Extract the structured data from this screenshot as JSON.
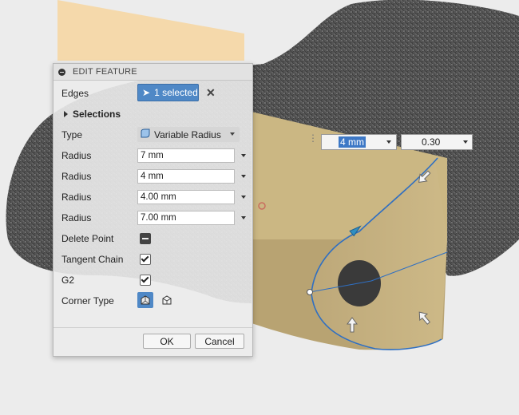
{
  "panel": {
    "title": "EDIT FEATURE",
    "edges_label": "Edges",
    "edges_value": "1 selected",
    "selections_label": "Selections",
    "type_label": "Type",
    "type_value": "Variable Radius",
    "radius_rows": [
      {
        "label": "Radius",
        "value": "7 mm"
      },
      {
        "label": "Radius",
        "value": "4 mm"
      },
      {
        "label": "Radius",
        "value": "4.00 mm"
      },
      {
        "label": "Radius",
        "value": "7.00 mm"
      }
    ],
    "delete_point_label": "Delete Point",
    "tangent_chain_label": "Tangent Chain",
    "tangent_chain_checked": true,
    "g2_label": "G2",
    "g2_checked": true,
    "corner_type_label": "Corner Type",
    "ok_label": "OK",
    "cancel_label": "Cancel"
  },
  "viewport": {
    "radius_input": "4 mm",
    "position_input": "0.30"
  },
  "colors": {
    "accent": "#4f88c6",
    "face": "#c9b581",
    "edge_curve": "#2f6fc2",
    "plane": "#f7d7a4"
  }
}
